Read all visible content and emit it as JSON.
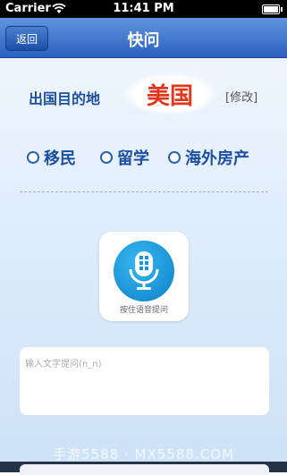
{
  "status_bar": {
    "carrier": "Carrier",
    "time": "11:41 PM"
  },
  "nav": {
    "back_label": "返回",
    "title": "快问"
  },
  "destination": {
    "label": "出国目的地",
    "country": "美国",
    "modify_label": "[修改]"
  },
  "options": [
    {
      "label": "移民",
      "selected": false
    },
    {
      "label": "留学",
      "selected": false
    },
    {
      "label": "海外房产",
      "selected": false
    }
  ],
  "voice": {
    "label": "按住语音提问",
    "icon": "microphone-icon"
  },
  "text_input": {
    "placeholder": "输入文字提问(n_n)",
    "value": ""
  },
  "watermark": "手游5588 · MX5588.COM",
  "colors": {
    "nav": "#2a61bf",
    "accent_text": "#1d4fa0",
    "country": "#e2361c",
    "mic": "#1596dc"
  }
}
